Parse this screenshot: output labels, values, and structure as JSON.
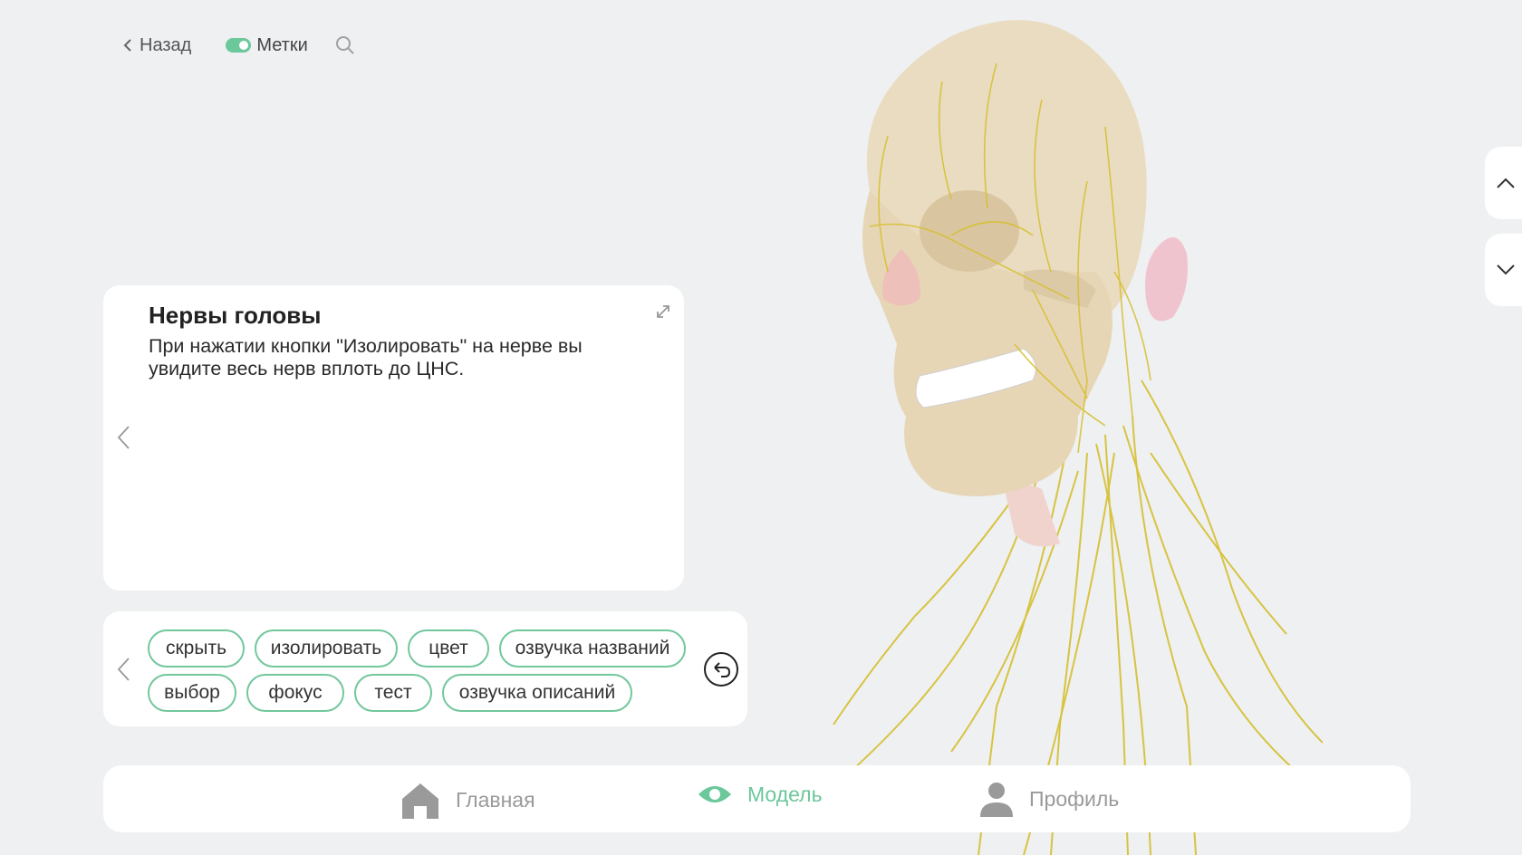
{
  "header": {
    "back_label": "Назад",
    "labels_toggle": "Метки",
    "labels_toggle_on": true
  },
  "info_card": {
    "title": "Нервы головы",
    "description": "При нажатии кнопки \"Изолировать\" на нерве вы увидите весь нерв вплоть до ЦНС."
  },
  "actions": {
    "row1": [
      "скрыть",
      "изолировать",
      "цвет",
      "озвучка названий"
    ],
    "row2": [
      "выбор",
      "фокус",
      "тест",
      "озвучка описаний"
    ]
  },
  "bottom_nav": {
    "items": [
      {
        "label": "Главная",
        "icon": "home-icon",
        "active": false
      },
      {
        "label": "Модель",
        "icon": "eye-icon",
        "active": true
      },
      {
        "label": "Профиль",
        "icon": "user-icon",
        "active": false
      }
    ]
  },
  "colors": {
    "accent": "#6cc79a",
    "background": "#eef0f2",
    "nerve": "#d8c33a"
  }
}
